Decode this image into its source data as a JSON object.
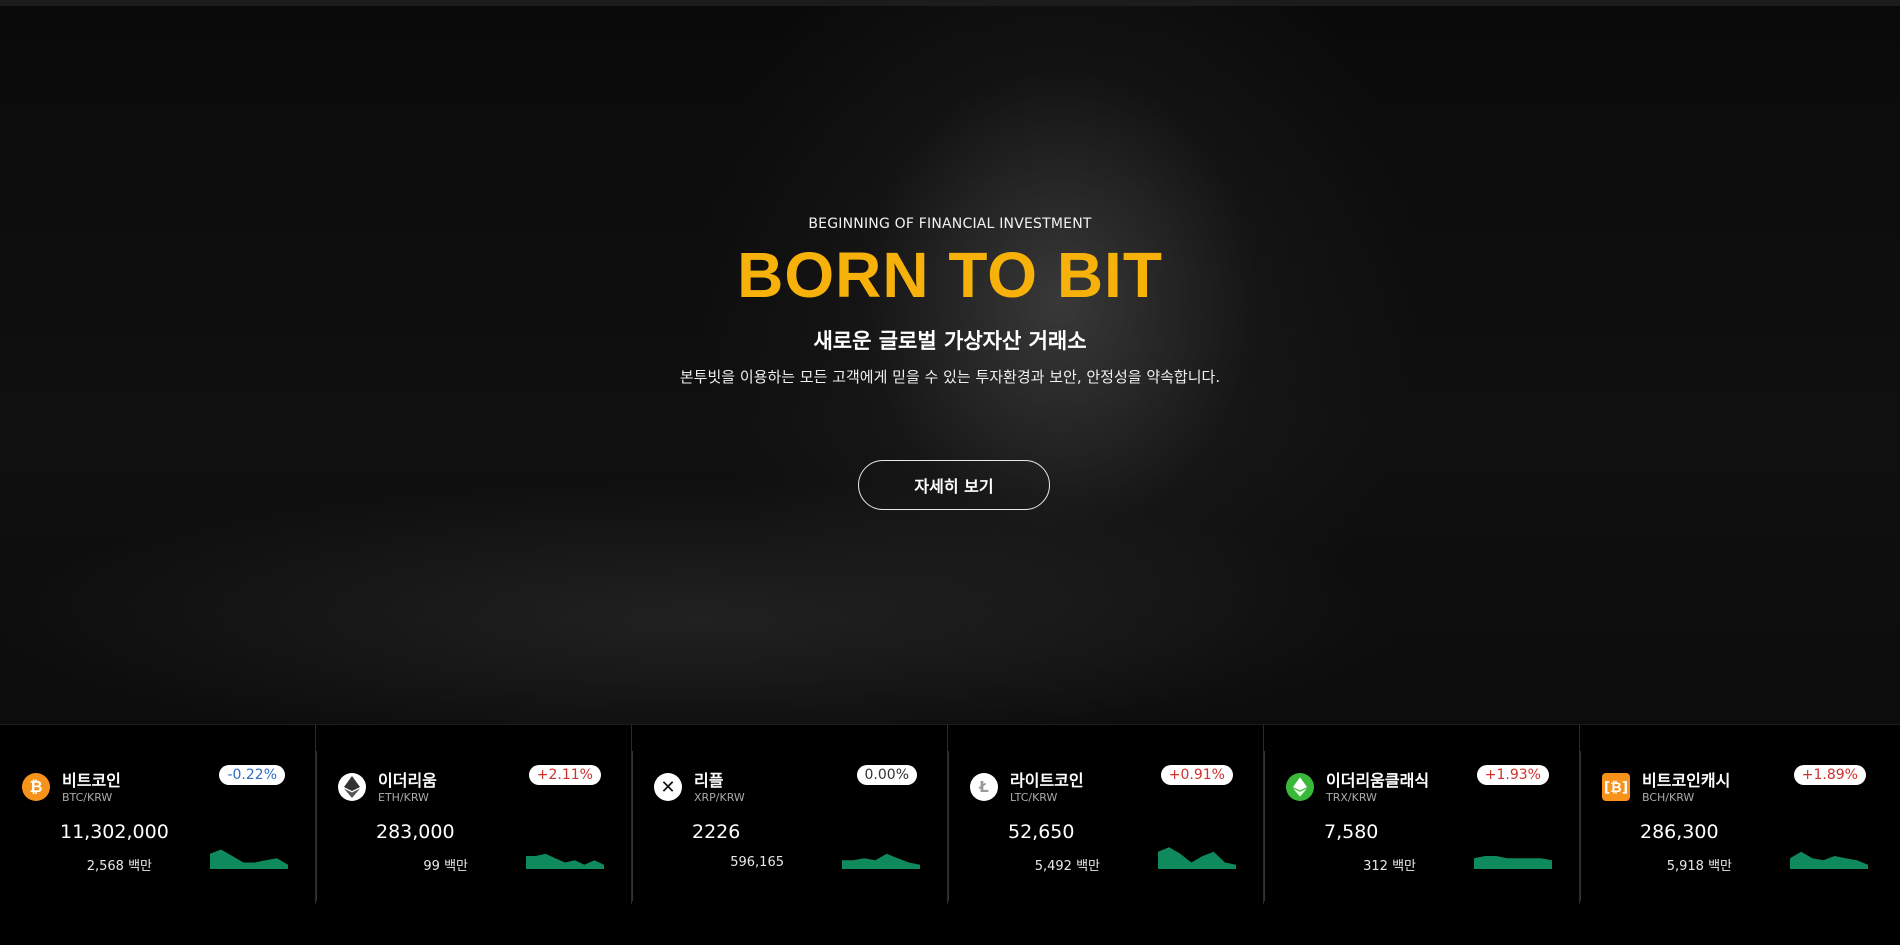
{
  "hero": {
    "tagline": "BEGINNING OF FINANCIAL INVESTMENT",
    "title": "BORN TO BIT",
    "subtitle": "새로운 글로벌 가상자산 거래소",
    "description": "본투빗을 이용하는 모든 고객에게 믿을 수 있는 투자환경과 보안, 안정성을 약속합니다.",
    "button_label": "자세히 보기"
  },
  "colors": {
    "brand": "#f7b10b",
    "up": "#d0312d",
    "down": "#2f6ebd",
    "spark_fill": "#0f8a5c"
  },
  "tickers": [
    {
      "name": "비트코인",
      "pair": "BTC/KRW",
      "change": "-0.22%",
      "direction": "down",
      "price": "11,302,000",
      "volume": "2,568 백만",
      "icon": "bitcoin-icon",
      "spark": [
        7,
        9,
        6,
        3,
        3,
        4,
        5,
        2
      ]
    },
    {
      "name": "이더리움",
      "pair": "ETH/KRW",
      "change": "+2.11%",
      "direction": "up",
      "price": "283,000",
      "volume": "99 백만",
      "icon": "ethereum-icon",
      "spark": [
        6,
        6,
        7,
        5,
        3,
        4,
        2,
        4,
        2
      ]
    },
    {
      "name": "리플",
      "pair": "XRP/KRW",
      "change": "0.00%",
      "direction": "flat",
      "price": "2226",
      "volume": "596,165",
      "icon": "ripple-icon",
      "spark": [
        4,
        4,
        5,
        4,
        7,
        5,
        3,
        2
      ]
    },
    {
      "name": "라이트코인",
      "pair": "LTC/KRW",
      "change": "+0.91%",
      "direction": "up",
      "price": "52,650",
      "volume": "5,492 백만",
      "icon": "litecoin-icon",
      "spark": [
        8,
        10,
        7,
        3,
        6,
        8,
        3,
        2
      ]
    },
    {
      "name": "이더리움클래식",
      "pair": "TRX/KRW",
      "change": "+1.93%",
      "direction": "up",
      "price": "7,580",
      "volume": "312 백만",
      "icon": "ethereum-classic-icon",
      "spark": [
        5,
        6,
        6,
        5,
        5,
        5,
        5,
        4
      ]
    },
    {
      "name": "비트코인캐시",
      "pair": "BCH/KRW",
      "change": "+1.89%",
      "direction": "up",
      "price": "286,300",
      "volume": "5,918 백만",
      "icon": "bitcoin-cash-icon",
      "spark": [
        5,
        8,
        5,
        4,
        6,
        5,
        4,
        2
      ]
    }
  ]
}
